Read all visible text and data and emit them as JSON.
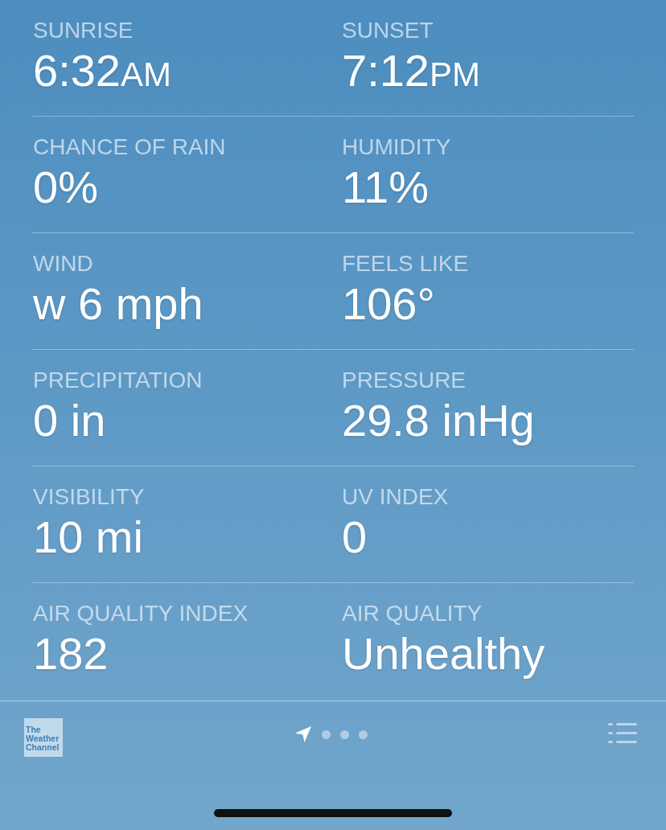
{
  "details": [
    {
      "label": "SUNRISE",
      "value": "6:32",
      "suffix": "AM"
    },
    {
      "label": "SUNSET",
      "value": "7:12",
      "suffix": "PM"
    },
    {
      "label": "CHANCE OF RAIN",
      "value": "0%"
    },
    {
      "label": "HUMIDITY",
      "value": "11%"
    },
    {
      "label": "WIND",
      "value": "w 6 mph"
    },
    {
      "label": "FEELS LIKE",
      "value": "106°"
    },
    {
      "label": "PRECIPITATION",
      "value": "0 in"
    },
    {
      "label": "PRESSURE",
      "value": "29.8 inHg"
    },
    {
      "label": "VISIBILITY",
      "value": "10 mi"
    },
    {
      "label": "UV INDEX",
      "value": "0"
    },
    {
      "label": "AIR QUALITY INDEX",
      "value": "182"
    },
    {
      "label": "AIR QUALITY",
      "value": "Unhealthy"
    }
  ],
  "toolbar": {
    "logo_lines": [
      "The",
      "Weather",
      "Channel"
    ],
    "pages": [
      {
        "kind": "location",
        "selected": true
      },
      {
        "kind": "dot",
        "selected": false
      },
      {
        "kind": "dot",
        "selected": false
      },
      {
        "kind": "dot",
        "selected": false
      }
    ]
  }
}
